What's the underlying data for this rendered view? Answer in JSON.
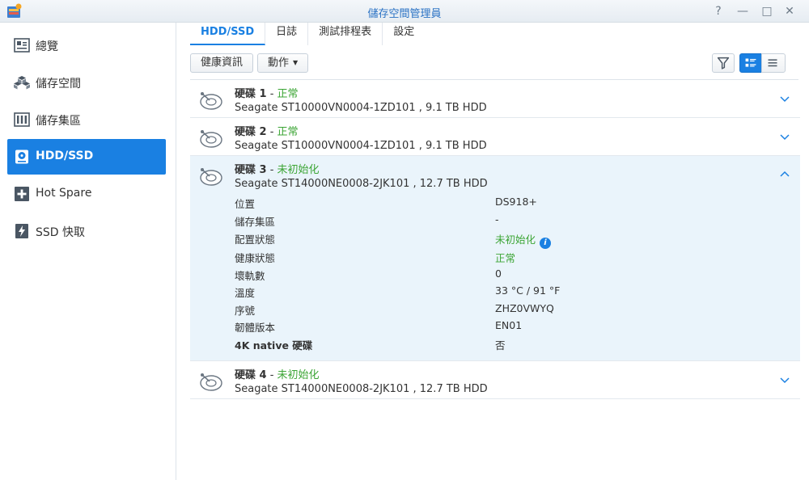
{
  "window": {
    "title": "儲存空間管理員",
    "help_glyph": "?",
    "pin_glyph": "—",
    "max_glyph": "□",
    "close_glyph": "✕"
  },
  "sidebar": {
    "items": [
      {
        "label": "總覽",
        "icon": "overview-icon"
      },
      {
        "label": "儲存空間",
        "icon": "storage-pool-icon"
      },
      {
        "label": "儲存集區",
        "icon": "volume-icon"
      },
      {
        "label": "HDD/SSD",
        "icon": "hdd-icon",
        "active": true
      },
      {
        "label": "Hot Spare",
        "icon": "hot-spare-icon"
      },
      {
        "label": "SSD 快取",
        "icon": "ssd-cache-icon"
      }
    ]
  },
  "tabs": [
    {
      "label": "HDD/SSD",
      "active": true
    },
    {
      "label": "日誌"
    },
    {
      "label": "測試排程表"
    },
    {
      "label": "設定"
    }
  ],
  "toolbar": {
    "health_info": "健康資訊",
    "action": "動作"
  },
  "disks": [
    {
      "name": "硬碟 1",
      "dash": " - ",
      "status": "正常",
      "model": "Seagate ST10000VN0004-1ZD101 , 9.1 TB HDD",
      "expanded": false
    },
    {
      "name": "硬碟 2",
      "dash": " - ",
      "status": "正常",
      "model": "Seagate ST10000VN0004-1ZD101 , 9.1 TB HDD",
      "expanded": false
    },
    {
      "name": "硬碟 3",
      "dash": " - ",
      "status": "未初始化",
      "model": "Seagate ST14000NE0008-2JK101 , 12.7 TB HDD",
      "expanded": true,
      "details": [
        {
          "label": "位置",
          "value": "DS918+"
        },
        {
          "label": "儲存集區",
          "value": "-"
        },
        {
          "label": "配置狀態",
          "value": "未初始化",
          "green": true,
          "info": true
        },
        {
          "label": "健康狀態",
          "value": "正常",
          "green": true
        },
        {
          "label": "壞軌數",
          "value": "0"
        },
        {
          "label": "溫度",
          "value": "33 °C / 91 °F"
        },
        {
          "label": "序號",
          "value": "ZHZ0VWYQ"
        },
        {
          "label": "韌體版本",
          "value": "EN01"
        },
        {
          "label": "4K native 硬碟",
          "value": "否",
          "bold": true
        }
      ]
    },
    {
      "name": "硬碟 4",
      "dash": " - ",
      "status": "未初始化",
      "model": "Seagate ST14000NE0008-2JK101 , 12.7 TB HDD",
      "expanded": false
    }
  ],
  "colors": {
    "accent": "#1a80e2",
    "ok_green": "#3ca535",
    "expanded_bg": "#eaf4fb"
  }
}
